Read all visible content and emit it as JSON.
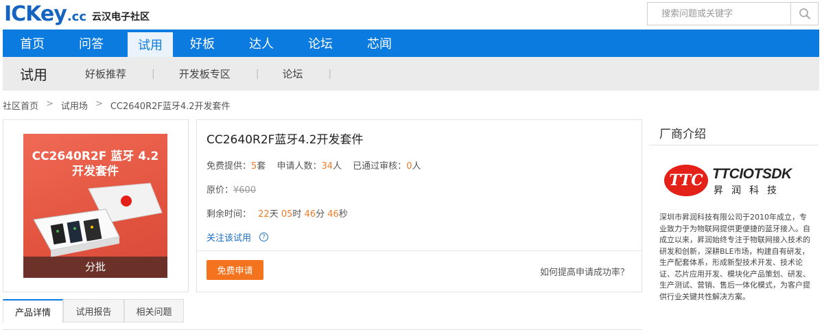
{
  "header": {
    "logo_main": "ICKey",
    "logo_cc": ".cc",
    "logo_sub": "云汉电子社区",
    "search_placeholder": "搜索问题或关键字",
    "search_icon": "search-icon"
  },
  "main_nav": {
    "items": [
      {
        "label": "首页",
        "active": false
      },
      {
        "label": "问答",
        "active": false
      },
      {
        "label": "试用",
        "active": true
      },
      {
        "label": "好板",
        "active": false
      },
      {
        "label": "达人",
        "active": false
      },
      {
        "label": "论坛",
        "active": false
      },
      {
        "label": "芯闻",
        "active": false
      }
    ]
  },
  "sub_nav": {
    "title": "试用",
    "items": [
      "好板推荐",
      "开发板专区",
      "论坛"
    ],
    "separator": "|"
  },
  "breadcrumb": {
    "items": [
      "社区首页",
      "试用场",
      "CC2640R2F蓝牙4.2开发套件"
    ],
    "separator": ">"
  },
  "product": {
    "image_title_line1": "CC2640R2F 蓝牙 4.2",
    "image_title_line2": "开发套件",
    "batch_label": "分批",
    "title": "CC2640R2F蓝牙4.2开发套件",
    "supply_label": "免费提供：",
    "supply_value": "5",
    "supply_unit": "套",
    "applicants_label": "申请人数：",
    "applicants_value": "34",
    "applicants_unit": "人",
    "approved_label": "已通过审核：",
    "approved_value": "0",
    "approved_unit": "人",
    "price_label": "原价：",
    "price_value": "¥600",
    "time_label": "剩余时间：",
    "days_value": "22",
    "days_unit": "天",
    "hours_value": "05",
    "hours_unit": "时",
    "minutes_value": "46",
    "minutes_unit": "分",
    "seconds_value": "46",
    "seconds_unit": "秒",
    "follow_label": "关注该试用",
    "help_icon_char": "?",
    "apply_button": "免费申请",
    "tip_link": "如何提高申请成功率？"
  },
  "vendor": {
    "title": "厂商介绍",
    "logo_mark": "TTC",
    "brand": "TTCIOTSDK",
    "brand_cn": "昇润科技",
    "description": "深圳市昇润科技有限公司于2010年成立，专业致力于为物联网提供更便捷的蓝牙接入。自成立以来，昇润始终专注于物联网接入技术的研发和创新，深耕BLE市场，构建自有研发，生产配套体系，形成新型技术开发、技术论证、芯片应用开发、模块化产品策划、研发、生产测试、营销、售后一体化模式，为客户提供行业关键共性解决方案。"
  },
  "tabs": {
    "items": [
      {
        "label": "产品详情",
        "active": true
      },
      {
        "label": "试用报告",
        "active": false
      },
      {
        "label": "相关问题",
        "active": false
      }
    ]
  },
  "colors": {
    "brand_blue": "#0b7be0",
    "accent_orange": "#f4731f",
    "link_blue": "#1a6fc6",
    "vendor_red": "#e32119"
  }
}
